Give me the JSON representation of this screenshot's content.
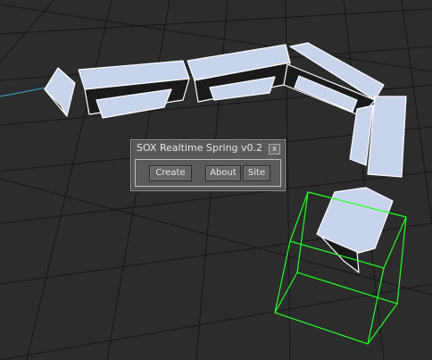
{
  "dialog": {
    "title": "SOX Realtime Spring v0.2",
    "close_label": "x",
    "buttons": {
      "create": "Create",
      "about": "About",
      "site": "Site"
    }
  },
  "colors": {
    "viewport_bg": "#2c2c2c",
    "grid_line": "#141414",
    "mesh_face": "#c8d3ec",
    "mesh_edge": "#ffffff",
    "selection_box": "#22ff22",
    "axis_line": "#3fa9d8"
  }
}
